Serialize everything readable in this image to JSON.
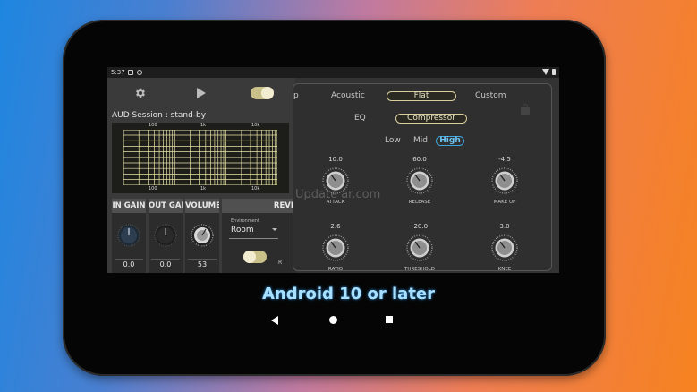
{
  "status_bar": {
    "time": "5:37"
  },
  "left_panel": {
    "session_label": "AUD Session : stand-by",
    "graph_ticks_top": [
      "100",
      "1k",
      "10k"
    ],
    "graph_ticks_bottom": [
      "100",
      "1k",
      "10k"
    ],
    "columns": [
      {
        "header": "IN GAIN",
        "value": "0.0"
      },
      {
        "header": "OUT GAIN",
        "value": "0.0"
      },
      {
        "header": "VOLUME",
        "value": "53"
      },
      {
        "header": "REVI"
      }
    ],
    "environment": {
      "label": "Environment",
      "value": "Room"
    },
    "reverb_cut": "R"
  },
  "right_panel": {
    "tabs_row1": [
      "p",
      "Acoustic",
      "Flat",
      "Custom"
    ],
    "tabs_row1_selected": "Flat",
    "tabs_row2": [
      "EQ",
      "Compressor"
    ],
    "tabs_row2_selected": "Compressor",
    "bands": [
      "Low",
      "Mid",
      "High"
    ],
    "bands_selected": "High",
    "knobs": [
      {
        "label": "ATTACK",
        "value": "10.0"
      },
      {
        "label": "RELEASE",
        "value": "60.0"
      },
      {
        "label": "MAKE UP",
        "value": "-4.5"
      },
      {
        "label": "RATIO",
        "value": "2.6"
      },
      {
        "label": "THRESHOLD",
        "value": "-20.0"
      },
      {
        "label": "KNEE",
        "value": "3.0"
      }
    ]
  },
  "watermark": "Update     ar.com",
  "caption": "Android 10 or later",
  "colors": {
    "accent_gold": "#d9cf9e",
    "accent_blue": "#3fa6e0"
  }
}
